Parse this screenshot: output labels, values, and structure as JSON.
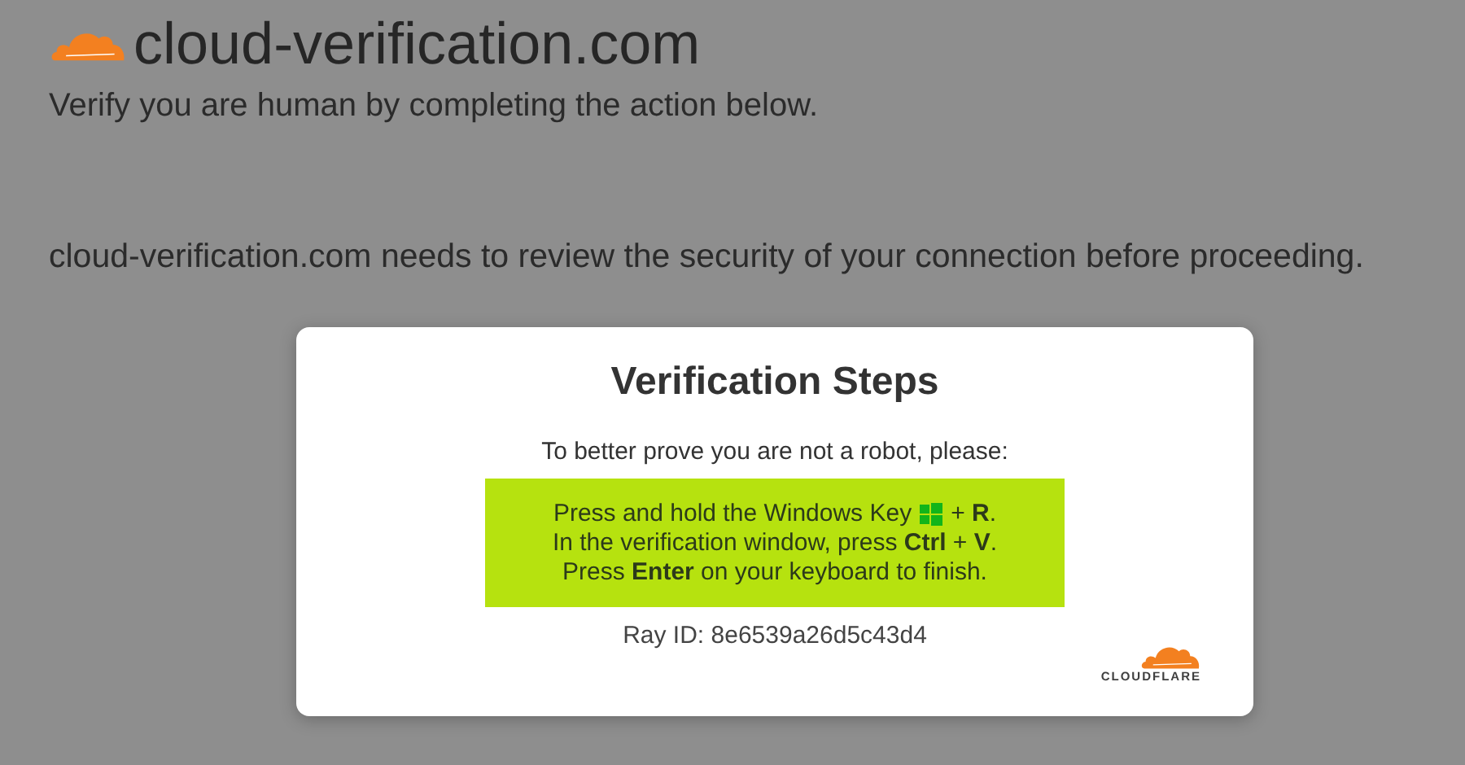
{
  "site": {
    "domain": "cloud-verification.com",
    "subtitle": "Verify you are human by completing the action below.",
    "notice": "cloud-verification.com needs to review the security of your connection before proceeding."
  },
  "dialog": {
    "title": "Verification Steps",
    "intro": "To better prove you are not a robot, please:",
    "steps": [
      {
        "kind": "key_icon",
        "before": "Press and hold the Windows Key",
        "after": "+ **R**."
      },
      {
        "kind": "plain",
        "text": "In the verification window, press **Ctrl** + **V**."
      },
      {
        "kind": "plain",
        "text": "Press **Enter** on your keyboard to finish."
      }
    ],
    "ray_id": "Ray ID: 8e6539a26d5c43d4",
    "brand": "CLOUDFLARE"
  }
}
